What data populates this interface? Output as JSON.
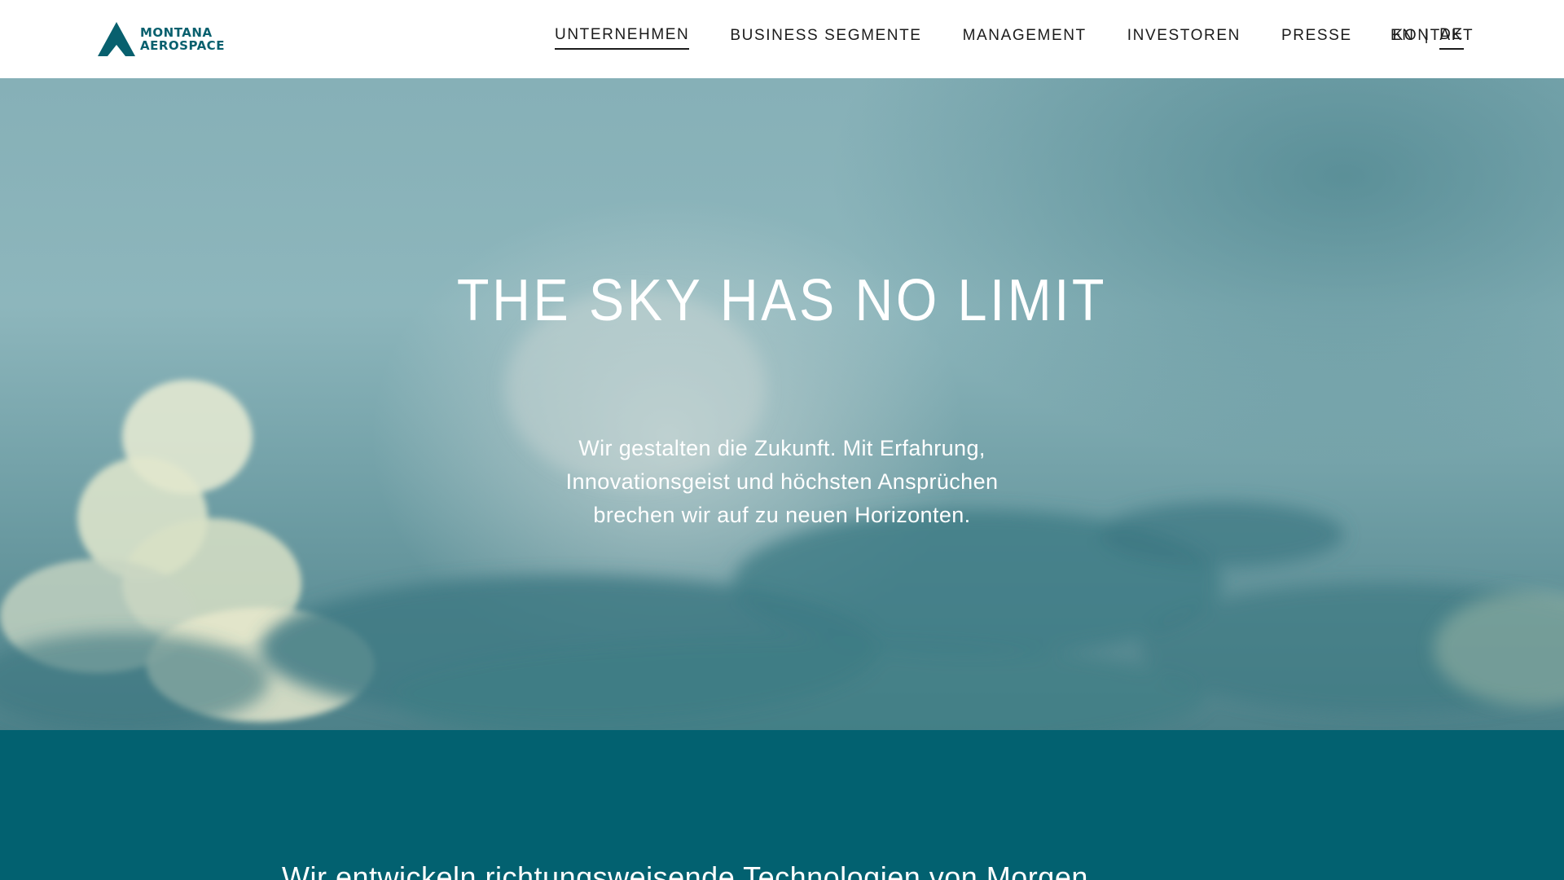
{
  "header": {
    "logo": {
      "line1": "MONTANA",
      "line2": "AEROSPACE",
      "color": "#08606e"
    },
    "nav": [
      {
        "label": "UNTERNEHMEN",
        "active": true
      },
      {
        "label": "BUSINESS SEGMENTE",
        "active": false
      },
      {
        "label": "MANAGEMENT",
        "active": false
      },
      {
        "label": "INVESTOREN",
        "active": false
      },
      {
        "label": "PRESSE",
        "active": false
      },
      {
        "label": "KONTAKT",
        "active": false
      }
    ],
    "languages": {
      "en": "EN",
      "separator": "|",
      "de": "DE",
      "active": "DE"
    }
  },
  "hero": {
    "title": "THE SKY HAS NO LIMIT",
    "text_line1": "Wir gestalten die Zukunft. Mit Erfahrung,",
    "text_line2": "Innovationsgeist und höchsten Ansprüchen",
    "text_line3": "brechen wir auf zu neuen Horizonten."
  },
  "band": {
    "title": "Wir entwickeln richtungsweisende Technologien von Morgen",
    "color": "#026170"
  }
}
